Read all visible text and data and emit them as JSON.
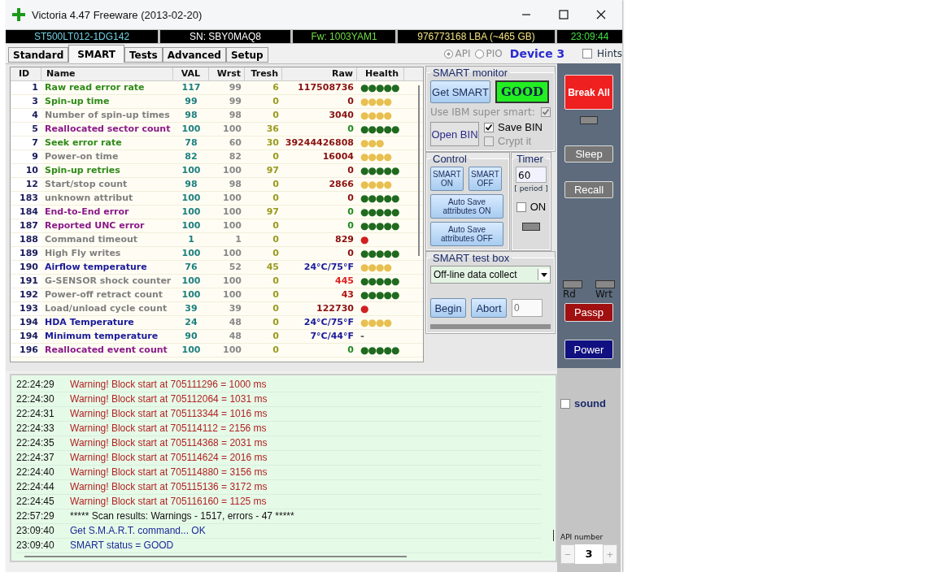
{
  "window": {
    "title": "Victoria 4.47  Freeware (2013-02-20)"
  },
  "info_bar": [
    "ST500LT012-1DG142",
    "SN: SBY0MAQ8",
    "Fw: 1003YAM1",
    "976773168 LBA (~465 GB)",
    "23:09:44"
  ],
  "tabs": [
    {
      "label": "Standard",
      "selected": false
    },
    {
      "label": "SMART",
      "selected": true
    },
    {
      "label": "Tests",
      "selected": false
    },
    {
      "label": "Advanced",
      "selected": false
    },
    {
      "label": "Setup",
      "selected": false
    }
  ],
  "api_modes": [
    {
      "label": "API",
      "selected": true
    },
    {
      "label": "PIO",
      "selected": false
    }
  ],
  "device": "Device 3",
  "hints": {
    "label": "Hints",
    "checked": false
  },
  "table": {
    "columns": [
      "ID",
      "Name",
      "VAL",
      "Wrst",
      "Tresh",
      "Raw",
      "Health"
    ],
    "rows": [
      {
        "id": "1",
        "name": {
          "text": "Raw read error rate",
          "color": "#2f8a1a"
        },
        "val": "117",
        "wrst": "99",
        "tresh": "6",
        "raw": {
          "text": "117508736",
          "color": "#8a1010"
        },
        "health": {
          "text": "●●●●●",
          "color": "#1f6a1f"
        }
      },
      {
        "id": "3",
        "name": {
          "text": "Spin-up time",
          "color": "#2f8a1a"
        },
        "val": "99",
        "wrst": "99",
        "tresh": "0",
        "raw": {
          "text": "0",
          "color": "#8a1010"
        },
        "health": {
          "text": "●●●●",
          "color": "#e8c050"
        }
      },
      {
        "id": "4",
        "name": {
          "text": "Number of spin-up times",
          "color": "#808080"
        },
        "val": "98",
        "wrst": "98",
        "tresh": "0",
        "raw": {
          "text": "3040",
          "color": "#8a1010"
        },
        "health": {
          "text": "●●●●",
          "color": "#e8c050"
        }
      },
      {
        "id": "5",
        "name": {
          "text": "Reallocated sector count",
          "color": "#8a1a8a"
        },
        "val": "100",
        "wrst": "100",
        "tresh": "36",
        "raw": {
          "text": "0",
          "color": "#1f8a1f"
        },
        "health": {
          "text": "●●●●●",
          "color": "#1f6a1f"
        }
      },
      {
        "id": "7",
        "name": {
          "text": "Seek error rate",
          "color": "#2f8a1a"
        },
        "val": "78",
        "wrst": "60",
        "tresh": "30",
        "raw": {
          "text": "39244426808",
          "color": "#8a1010"
        },
        "health": {
          "text": "●●●",
          "color": "#e8c050"
        }
      },
      {
        "id": "9",
        "name": {
          "text": "Power-on time",
          "color": "#808080"
        },
        "val": "82",
        "wrst": "82",
        "tresh": "0",
        "raw": {
          "text": "16004",
          "color": "#8a1010"
        },
        "health": {
          "text": "●●●●",
          "color": "#e8c050"
        }
      },
      {
        "id": "10",
        "name": {
          "text": "Spin-up retries",
          "color": "#2f8a1a"
        },
        "val": "100",
        "wrst": "100",
        "tresh": "97",
        "raw": {
          "text": "0",
          "color": "#8a1010"
        },
        "health": {
          "text": "●●●●●",
          "color": "#1f6a1f"
        }
      },
      {
        "id": "12",
        "name": {
          "text": "Start/stop count",
          "color": "#808080"
        },
        "val": "98",
        "wrst": "98",
        "tresh": "0",
        "raw": {
          "text": "2866",
          "color": "#8a1010"
        },
        "health": {
          "text": "●●●●",
          "color": "#e8c050"
        }
      },
      {
        "id": "183",
        "name": {
          "text": "unknown attribut",
          "color": "#808080"
        },
        "val": "100",
        "wrst": "100",
        "tresh": "0",
        "raw": {
          "text": "0",
          "color": "#8a1010"
        },
        "health": {
          "text": "●●●●●",
          "color": "#1f6a1f"
        }
      },
      {
        "id": "184",
        "name": {
          "text": "End-to-End error",
          "color": "#8a1a8a"
        },
        "val": "100",
        "wrst": "100",
        "tresh": "97",
        "raw": {
          "text": "0",
          "color": "#1f8a1f"
        },
        "health": {
          "text": "●●●●●",
          "color": "#1f6a1f"
        }
      },
      {
        "id": "187",
        "name": {
          "text": "Reported UNC error",
          "color": "#8a1a8a"
        },
        "val": "100",
        "wrst": "100",
        "tresh": "0",
        "raw": {
          "text": "0",
          "color": "#1f8a1f"
        },
        "health": {
          "text": "●●●●●",
          "color": "#1f6a1f"
        }
      },
      {
        "id": "188",
        "name": {
          "text": "Command timeout",
          "color": "#808080"
        },
        "val": "1",
        "wrst": "1",
        "tresh": "0",
        "raw": {
          "text": "829",
          "color": "#8a1010"
        },
        "health": {
          "text": "●",
          "color": "#d02020"
        }
      },
      {
        "id": "189",
        "name": {
          "text": "High Fly writes",
          "color": "#808080"
        },
        "val": "100",
        "wrst": "100",
        "tresh": "0",
        "raw": {
          "text": "0",
          "color": "#8a1010"
        },
        "health": {
          "text": "●●●●●",
          "color": "#1f6a1f"
        }
      },
      {
        "id": "190",
        "name": {
          "text": "Airflow temperature",
          "color": "#1a1a9a"
        },
        "val": "76",
        "wrst": "52",
        "tresh": "45",
        "raw": {
          "text": "24°C/75°F",
          "color": "#1a1a9a"
        },
        "health": {
          "text": "●●●●",
          "color": "#e8c050"
        }
      },
      {
        "id": "191",
        "name": {
          "text": "G-SENSOR shock counter",
          "color": "#808080"
        },
        "val": "100",
        "wrst": "100",
        "tresh": "0",
        "raw": {
          "text": "445",
          "color": "#e02020"
        },
        "health": {
          "text": "●●●●●",
          "color": "#1f6a1f"
        }
      },
      {
        "id": "192",
        "name": {
          "text": "Power-off retract count",
          "color": "#808080"
        },
        "val": "100",
        "wrst": "100",
        "tresh": "0",
        "raw": {
          "text": "43",
          "color": "#b01010"
        },
        "health": {
          "text": "●●●●●",
          "color": "#1f6a1f"
        }
      },
      {
        "id": "193",
        "name": {
          "text": "Load/unload cycle count",
          "color": "#808080"
        },
        "val": "39",
        "wrst": "39",
        "tresh": "0",
        "raw": {
          "text": "122730",
          "color": "#8a1010"
        },
        "health": {
          "text": "●",
          "color": "#d02020"
        }
      },
      {
        "id": "194",
        "name": {
          "text": "HDA Temperature",
          "color": "#1a1a9a"
        },
        "val": "24",
        "wrst": "48",
        "tresh": "0",
        "raw": {
          "text": "24°C/75°F",
          "color": "#1a1a9a"
        },
        "health": {
          "text": "●●●●",
          "color": "#e8c050"
        }
      },
      {
        "id": "194",
        "name": {
          "text": "Minimum temperature",
          "color": "#1a1a9a"
        },
        "val": "90",
        "wrst": "48",
        "tresh": "0",
        "raw": {
          "text": "7°C/44°F",
          "color": "#1a1a9a"
        },
        "health": {
          "text": "-",
          "color": "#606060"
        }
      },
      {
        "id": "196",
        "name": {
          "text": "Reallocated event count",
          "color": "#8a1a8a"
        },
        "val": "100",
        "wrst": "100",
        "tresh": "0",
        "raw": {
          "text": "0",
          "color": "#1f8a1f"
        },
        "health": {
          "text": "●●●●●",
          "color": "#1f6a1f"
        }
      }
    ]
  },
  "smart_monitor": {
    "title": "SMART monitor",
    "get_button": "Get SMART",
    "status": "GOOD",
    "ibm_super_smart": {
      "label": "Use IBM super smart:",
      "checked": true,
      "disabled": true
    },
    "open_bin": "Open BIN",
    "save_bin": {
      "label": "Save BIN",
      "checked": true,
      "disabled": false
    },
    "crypt": {
      "label": "Crypt it",
      "checked": false,
      "disabled": true
    }
  },
  "control": {
    "title": "Control",
    "buttons": [
      "SMART ON",
      "SMART OFF",
      "Auto Save attributes ON",
      "Auto Save attributes OFF"
    ]
  },
  "timer": {
    "title": "Timer",
    "value": "60",
    "unit": "[ period ]",
    "on": {
      "label": "ON",
      "checked": false
    }
  },
  "test_box": {
    "title": "SMART test box",
    "selection": "Off-line data collect",
    "buttons": [
      "Begin",
      "Abort"
    ],
    "placeholder": "0",
    "progress": {
      "level": 0
    }
  },
  "side": {
    "break_all": "Break All",
    "sleep": "Sleep",
    "recall": "Recall",
    "rd": "Rd",
    "wrt": "Wrt",
    "passp": "Passp",
    "power": "Power",
    "sound": {
      "label": "sound",
      "checked": false
    },
    "api_number_label": "API number",
    "api_number": "3",
    "minus": "−",
    "plus": "+"
  },
  "log": [
    {
      "time": "22:24:29",
      "text": "Warning! Block start at 705111296 = 1000 ms",
      "color": "#b22222"
    },
    {
      "time": "22:24:30",
      "text": "Warning! Block start at 705112064 = 1031 ms",
      "color": "#b22222"
    },
    {
      "time": "22:24:31",
      "text": "Warning! Block start at 705113344 = 1016 ms",
      "color": "#b22222"
    },
    {
      "time": "22:24:33",
      "text": "Warning! Block start at 705114112 = 2156 ms",
      "color": "#b22222"
    },
    {
      "time": "22:24:35",
      "text": "Warning! Block start at 705114368 = 2031 ms",
      "color": "#b22222"
    },
    {
      "time": "22:24:37",
      "text": "Warning! Block start at 705114624 = 2016 ms",
      "color": "#b22222"
    },
    {
      "time": "22:24:40",
      "text": "Warning! Block start at 705114880 = 3156 ms",
      "color": "#b22222"
    },
    {
      "time": "22:24:44",
      "text": "Warning! Block start at 705115136 = 3172 ms",
      "color": "#b22222"
    },
    {
      "time": "22:24:45",
      "text": "Warning! Block start at 705116160 = 1125 ms",
      "color": "#b22222"
    },
    {
      "time": "22:57:29",
      "text": "***** Scan results: Warnings - 1517, errors - 47 *****",
      "color": "#111111"
    },
    {
      "time": "23:09:40",
      "text": "Get S.M.A.R.T. command... OK",
      "color": "#1a2a9a"
    },
    {
      "time": "23:09:40",
      "text": "SMART status = GOOD",
      "color": "#1a2a9a"
    }
  ]
}
